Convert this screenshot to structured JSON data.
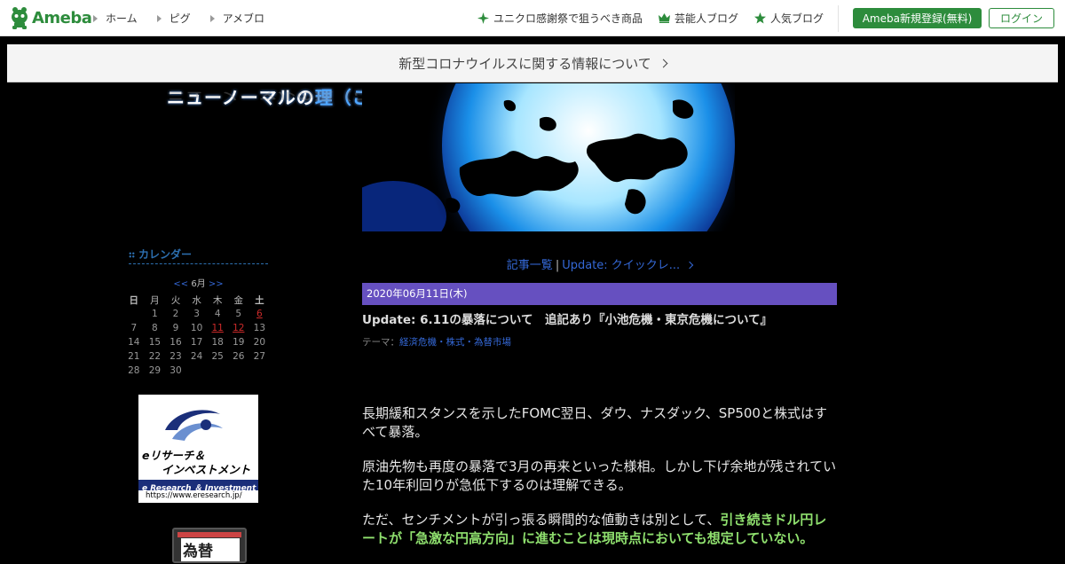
{
  "header": {
    "logo_text": "Ameba",
    "nav": [
      "ホーム",
      "ピグ",
      "アメブロ"
    ],
    "links": [
      {
        "label": "ユニクロ感謝祭で狙うべき商品",
        "icon": "sparkle-icon"
      },
      {
        "label": "芸能人ブログ",
        "icon": "crown-icon"
      },
      {
        "label": "人気ブログ",
        "icon": "star-icon"
      }
    ],
    "register_label": "Ameba新規登録(無料)",
    "login_label": "ログイン",
    "brand_color": "#2d8c3c"
  },
  "banner": {
    "text": "新型コロナウイルスに関する情報について"
  },
  "blog": {
    "title_main": "ニューノーマルの",
    "title_accent": "理（ことわり）"
  },
  "sidebar": {
    "calendar_heading": "カレンダー",
    "cal_prev": "<<",
    "cal_month": "6月",
    "cal_next": ">>",
    "weekdays": [
      "日",
      "月",
      "火",
      "水",
      "木",
      "金",
      "土"
    ],
    "weeks": [
      [
        "",
        "1",
        "2",
        "3",
        "4",
        "5",
        "6"
      ],
      [
        "7",
        "8",
        "9",
        "10",
        "11",
        "12",
        "13"
      ],
      [
        "14",
        "15",
        "16",
        "17",
        "18",
        "19",
        "20"
      ],
      [
        "21",
        "22",
        "23",
        "24",
        "25",
        "26",
        "27"
      ],
      [
        "28",
        "29",
        "30",
        "",
        "",
        "",
        ""
      ]
    ],
    "linked_days": [
      "6",
      "11",
      "12"
    ],
    "ad1": {
      "line1": "eリサーチ＆",
      "line2": "インベストメント",
      "line3": "e Research ＆ Investment",
      "url": "https://www.eresearch.jp/"
    },
    "ad2": {
      "text": "為替"
    }
  },
  "entry": {
    "nav_list": "記事一覧",
    "nav_next": "Update: クイックレ...",
    "date": "2020年06月11日(木)",
    "title": "Update: 6.11の暴落について　追記あり『小池危機・東京危機について』",
    "theme_label": "テーマ：",
    "theme_value": "経済危機・株式・為替市場",
    "paragraphs": [
      "長期緩和スタンスを示したFOMC翌日、ダウ、ナスダック、SP500と株式はすべて暴落。",
      "原油先物も再度の暴落で3月の再来といった様相。しかし下げ余地が残されていた10年利回りが急低下するのは理解できる。"
    ],
    "para3_plain": "ただ、センチメントが引っ張る瞬間的な値動きは別として、",
    "para3_highlight": "引き続きドル円レートが「急激な円高方向」に進むことは現時点においても想定していない。"
  }
}
